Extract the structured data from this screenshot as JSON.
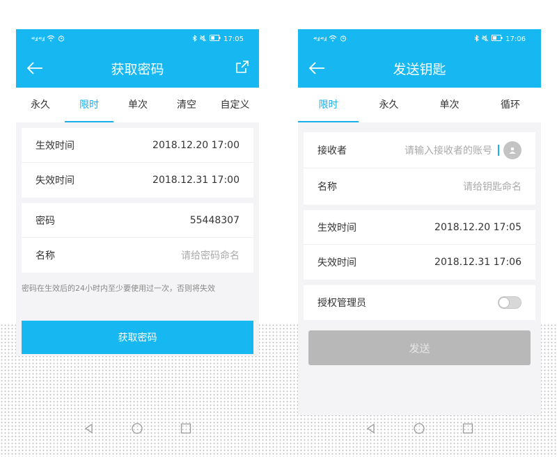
{
  "left": {
    "status": {
      "signal": "⁴⁶.ıl ⁴⁶.ıl",
      "time": "17:05"
    },
    "title": "获取密码",
    "tabs": [
      {
        "label": "永久"
      },
      {
        "label": "限时"
      },
      {
        "label": "单次"
      },
      {
        "label": "清空"
      },
      {
        "label": "自定义"
      }
    ],
    "active_tab": "限时",
    "time_rows": [
      {
        "label": "生效时间",
        "value": "2018.12.20 17:00"
      },
      {
        "label": "失效时间",
        "value": "2018.12.31 17:00"
      }
    ],
    "password_row": {
      "label": "密码",
      "value": "55448307"
    },
    "name_row": {
      "label": "名称",
      "placeholder": "请给密码命名"
    },
    "note": "密码在生效后的24小时内至少要使用过一次，否则将失效",
    "button": "获取密码"
  },
  "right": {
    "status": {
      "signal": "⁴⁶.ıl ⁴⁶.ıl",
      "time": "17:06"
    },
    "title": "发送钥匙",
    "tabs": [
      {
        "label": "限时"
      },
      {
        "label": "永久"
      },
      {
        "label": "单次"
      },
      {
        "label": "循环"
      }
    ],
    "active_tab": "限时",
    "receiver_row": {
      "label": "接收者",
      "placeholder": "请输入接收者的账号"
    },
    "name_row": {
      "label": "名称",
      "placeholder": "请给钥匙命名"
    },
    "time_rows": [
      {
        "label": "生效时间",
        "value": "2018.12.20 17:05"
      },
      {
        "label": "失效时间",
        "value": "2018.12.31 17:06"
      }
    ],
    "admin_row": {
      "label": "授权管理员",
      "toggle_on": false
    },
    "button": "发送"
  },
  "colors": {
    "accent": "#17b8f2",
    "tab_active": "#1aaeea",
    "disabled_button": "#b8b8b8"
  }
}
